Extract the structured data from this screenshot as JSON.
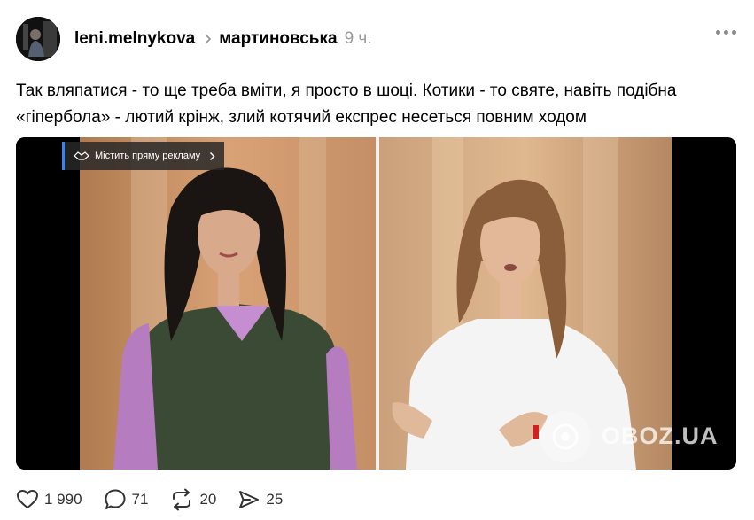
{
  "post": {
    "username": "leni.melnykova",
    "topic": "мартиновська",
    "time": "9 ч.",
    "text": "Так вляпатися - то ще треба вміти, я просто в шоці. Котики - то святе, навіть подібна «гіпербола» - лютий крінж, злий котячий експрес несеться повним ходом"
  },
  "media": {
    "ad_badge": "Містить пряму рекламу",
    "watermark": "OBOZ.UA"
  },
  "actions": {
    "likes": "1 990",
    "comments": "71",
    "reposts": "20",
    "shares": "25"
  },
  "icons": {
    "more": "more-dots-icon",
    "like": "heart-icon",
    "comment": "comment-bubble-icon",
    "repost": "repost-arrows-icon",
    "share": "send-icon"
  }
}
